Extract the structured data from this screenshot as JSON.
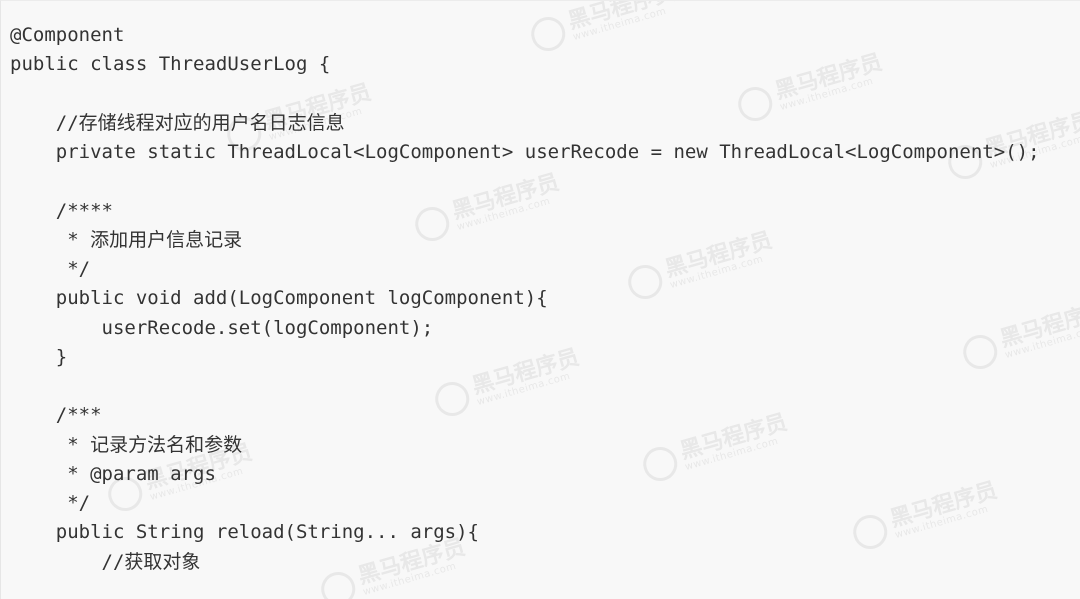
{
  "code": {
    "lines": [
      "@Component",
      "public class ThreadUserLog {",
      "",
      "    //存储线程对应的用户名日志信息",
      "    private static ThreadLocal<LogComponent> userRecode = new ThreadLocal<LogComponent>();",
      "",
      "    /****",
      "     * 添加用户信息记录",
      "     */",
      "    public void add(LogComponent logComponent){",
      "        userRecode.set(logComponent);",
      "    }",
      "",
      "    /***",
      "     * 记录方法名和参数",
      "     * @param args",
      "     */",
      "    public String reload(String... args){",
      "        //获取对象"
    ]
  },
  "watermark": {
    "brand": "黑马程序员",
    "url": "www.itheima.com"
  },
  "colors": {
    "background": "#f8f8f8",
    "text": "#333333"
  }
}
